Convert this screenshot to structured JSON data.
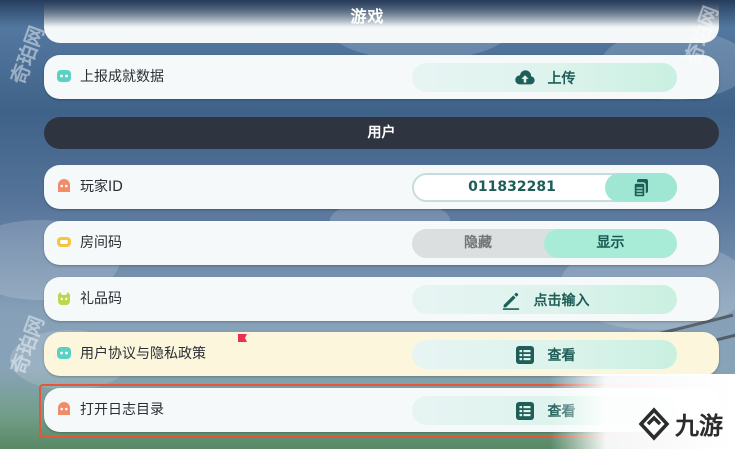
{
  "page": {
    "title": "游戏"
  },
  "rows": {
    "upload": {
      "label": "上报成就数据",
      "action_label": "上传",
      "icon": "cloud-upload-icon",
      "icon_color": "#5ad1c2"
    },
    "player_id": {
      "label": "玩家ID",
      "value": "011832281",
      "icon": "player-icon",
      "icon_color": "#f08c6a"
    },
    "room_code": {
      "label": "房间码",
      "off_label": "隐藏",
      "on_label": "显示",
      "selected": "显示",
      "icon": "room-icon",
      "icon_color": "#f4c542"
    },
    "gift_code": {
      "label": "礼品码",
      "action_label": "点击输入",
      "icon": "gift-icon",
      "icon_color": "#b9d84a"
    },
    "agreement": {
      "label": "用户协议与隐私政策",
      "action_label": "查看",
      "icon": "document-icon",
      "icon_color": "#5ad1c2"
    },
    "log_dir": {
      "label": "打开日志目录",
      "action_label": "查看",
      "icon": "folder-icon",
      "icon_color": "#f08c6a"
    }
  },
  "sections": {
    "user": "用户"
  },
  "colors": {
    "accent": "#1f5e58",
    "accent_light": "#a8ecd8",
    "highlight_box": "#e4553a"
  },
  "watermarks": {
    "corner_brand": "九游",
    "side_text": "奇珀网"
  }
}
